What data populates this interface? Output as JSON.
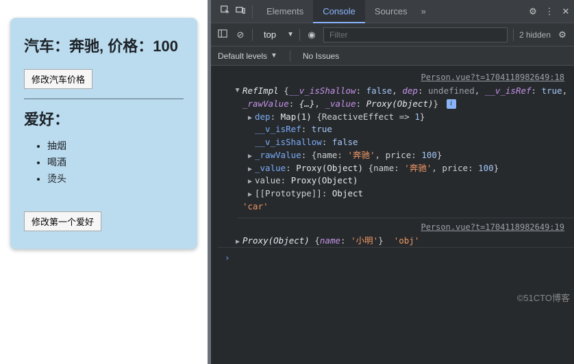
{
  "left": {
    "title": "汽车：奔驰, 价格：100",
    "btn_change_price": "修改汽车价格",
    "hobby_heading": "爱好：",
    "hobbies": [
      "抽烟",
      "喝酒",
      "烫头"
    ],
    "btn_change_hobby": "修改第一个爱好"
  },
  "tabs": {
    "elements": "Elements",
    "console": "Console",
    "sources": "Sources",
    "more": "»"
  },
  "filterbar": {
    "top": "top",
    "filter_placeholder": "Filter",
    "hidden": "2 hidden"
  },
  "levels": {
    "default": "Default levels",
    "issues": "No Issues"
  },
  "src1": "Person.vue?t=1704118982649:18",
  "src2": "Person.vue?t=1704118982649:19",
  "refimpl": {
    "head": "RefImpl",
    "v_isShallow_k": "__v_isShallow",
    "v_isShallow_v": "false",
    "dep_k": "dep",
    "dep_v": "undefined",
    "v_isRef_k": "__v_isRef",
    "v_isRef_v": "true",
    "rawValue_k": "_rawValue",
    "rawValue_v": "{…}",
    "value_k": "_value",
    "value_v": "Proxy(Object)"
  },
  "expanded": {
    "dep_k": "dep",
    "dep_v_a": "Map(1)",
    "dep_v_b": "{ReactiveEffect => ",
    "dep_v_c": "1",
    "dep_v_d": "}",
    "isref_k": "__v_isRef",
    "isref_v": "true",
    "isshallow_k": "__v_isShallow",
    "isshallow_v": "false",
    "raw_k": "_rawValue",
    "raw_name_k": "name",
    "raw_name_v": "'奔驰'",
    "raw_price_k": "price",
    "raw_price_v": "100",
    "val_k": "_value",
    "val_proxy": "Proxy(Object)",
    "valget_k": "value",
    "valget_v": "Proxy(Object)",
    "proto_k": "[[Prototype]]",
    "proto_v": "Object",
    "car_str": "'car'"
  },
  "line2": {
    "proxy": "Proxy(Object)",
    "name_k": "name",
    "name_v": "'小明'",
    "obj_str": "'obj'"
  },
  "watermark": "©51CTO博客"
}
